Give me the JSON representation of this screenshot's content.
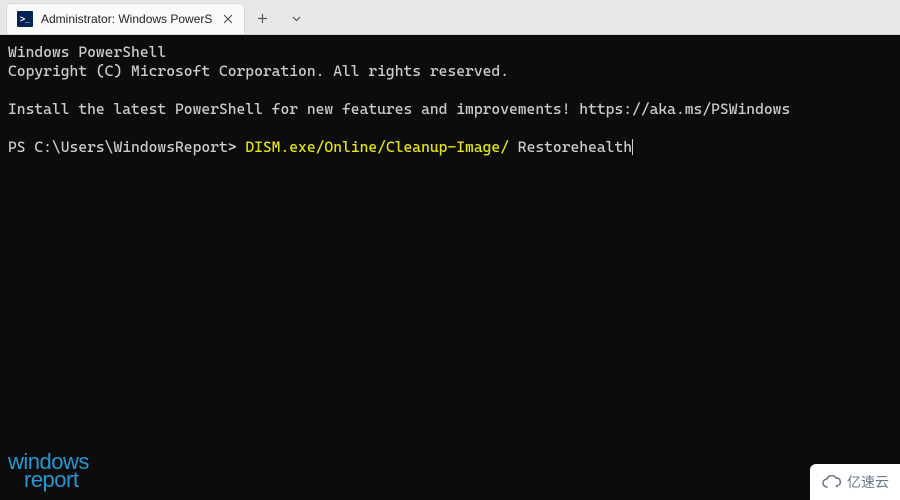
{
  "tab": {
    "title": "Administrator: Windows PowerS",
    "icon_label": ">_"
  },
  "terminal": {
    "header1": "Windows PowerShell",
    "header2": "Copyright (C) Microsoft Corporation. All rights reserved.",
    "install_msg": "Install the latest PowerShell for new features and improvements! https://aka.ms/PSWindows",
    "prompt": "PS C:\\Users\\WindowsReport> ",
    "command_highlight": "DISM.exe/Online/Cleanup-Image/",
    "command_rest": " Restorehealth"
  },
  "watermarks": {
    "wr_top": "windows",
    "wr_bottom": "report",
    "yisu": "亿速云"
  },
  "colors": {
    "terminal_bg": "#0c0c0c",
    "terminal_fg": "#cccccc",
    "command_yellow": "#e5e510",
    "wr_blue": "#2596d1"
  }
}
